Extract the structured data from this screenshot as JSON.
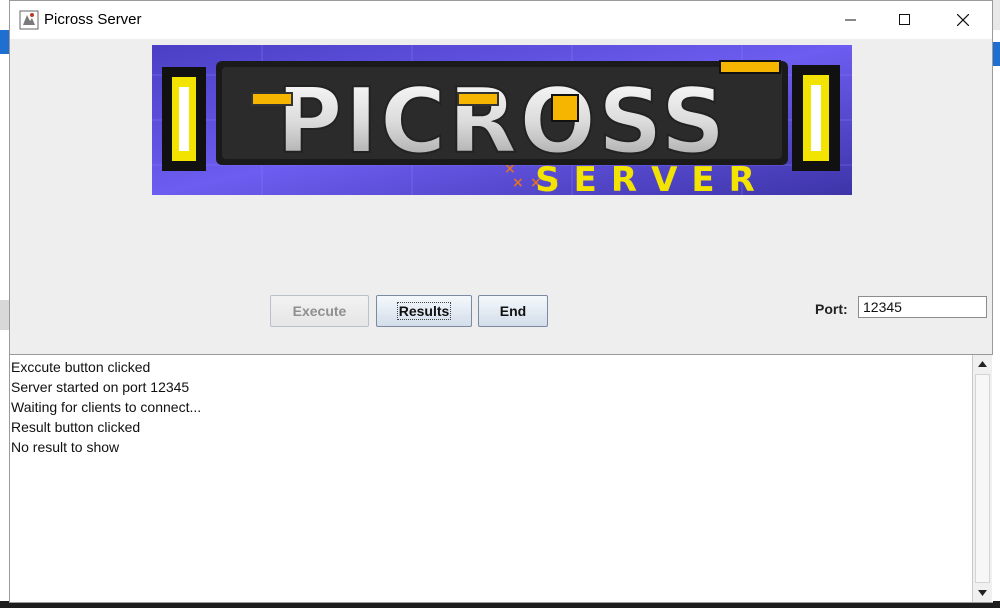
{
  "window": {
    "title": "Picross Server"
  },
  "banner": {
    "logo_text": "PICROSS",
    "logo_subtext": "SERVER"
  },
  "controls": {
    "execute_label": "Execute",
    "execute_enabled": false,
    "results_label": "Results",
    "end_label": "End",
    "port_label": "Port:",
    "port_value": "12345"
  },
  "log": {
    "lines": [
      "Exccute button clicked",
      "Server started on port 12345",
      "Waiting for clients to connect...",
      "Result button clicked",
      "No result to show"
    ]
  },
  "colors": {
    "banner_bg": "#5a4fd6",
    "logo_yellow": "#f2e400",
    "accent_blue": "#1e6fd0"
  },
  "icons": [
    "app-icon",
    "minimize-icon",
    "maximize-icon",
    "close-icon",
    "scroll-up-icon",
    "scroll-down-icon"
  ]
}
